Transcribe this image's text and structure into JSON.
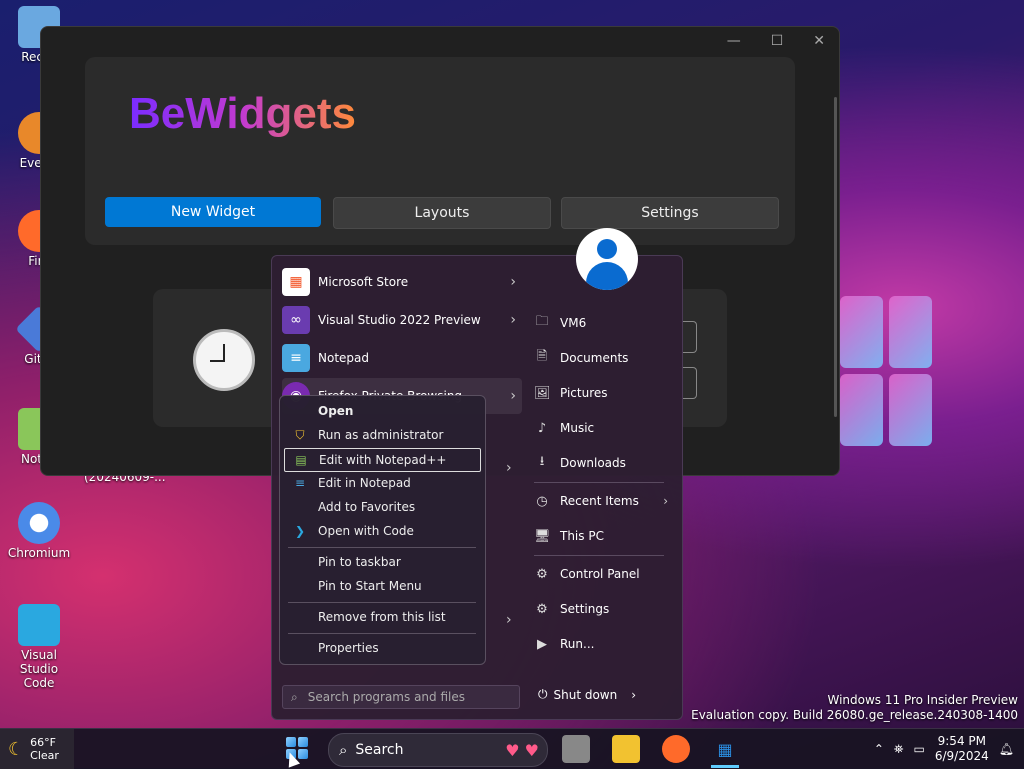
{
  "desktop": {
    "icons": [
      {
        "label": "Recyc",
        "icon": "recycle-bin-icon",
        "color": "#6aa8e0"
      },
      {
        "label": "Everyt",
        "icon": "everything-search-icon",
        "color": "#e8882a"
      },
      {
        "label": "Fire",
        "icon": "firefox-icon",
        "color": "#ff6a2a"
      },
      {
        "label": "Git B",
        "icon": "git-bash-icon",
        "color": "#4a7ad8"
      },
      {
        "label": "Notep",
        "icon": "notepadpp-icon",
        "color": "#8ac65a"
      },
      {
        "label": "Chromium",
        "icon": "chromium-icon",
        "color": "#4a8ae8"
      },
      {
        "label": "Visual Studio Code",
        "icon": "vscode-icon",
        "color": "#2aa8e0"
      }
    ],
    "stray_label": "(20240609-...",
    "eval_line1": "Windows 11 Pro Insider Preview",
    "eval_line2": "Evaluation copy. Build 26080.ge_release.240308-1400"
  },
  "bewidgets": {
    "title": "BeWidgets",
    "buttons": {
      "new_widget": "New Widget",
      "layouts": "Layouts",
      "settings": "Settings"
    },
    "window_controls": {
      "minimize": "—",
      "maximize": "☐",
      "close": "✕"
    }
  },
  "start_menu": {
    "programs": [
      {
        "label": "Microsoft Store",
        "icon": "microsoft-store-icon",
        "chevron": true
      },
      {
        "label": "Visual Studio 2022 Preview",
        "icon": "visual-studio-icon",
        "chevron": true
      },
      {
        "label": "Notepad",
        "icon": "notepad-icon",
        "chevron": false
      },
      {
        "label": "Firefox Private Browsing",
        "icon": "firefox-private-icon",
        "chevron": true
      }
    ],
    "right_items": [
      {
        "label": "VM6",
        "icon": "user-folder-icon",
        "glyph": "🗀"
      },
      {
        "label": "Documents",
        "icon": "documents-icon",
        "glyph": "🗎"
      },
      {
        "label": "Pictures",
        "icon": "pictures-icon",
        "glyph": "🖼"
      },
      {
        "label": "Music",
        "icon": "music-icon",
        "glyph": "♪"
      },
      {
        "label": "Downloads",
        "icon": "downloads-icon",
        "glyph": "⭳"
      },
      {
        "label": "Recent Items",
        "icon": "recent-items-icon",
        "glyph": "◷",
        "chevron": true
      },
      {
        "label": "This PC",
        "icon": "this-pc-icon",
        "glyph": "🖥"
      },
      {
        "label": "Control Panel",
        "icon": "control-panel-icon",
        "glyph": "⚙"
      },
      {
        "label": "Settings",
        "icon": "settings-gear-icon",
        "glyph": "⚙"
      },
      {
        "label": "Run...",
        "icon": "run-icon",
        "glyph": "▶"
      }
    ],
    "search_placeholder": "Search programs and files",
    "shutdown_label": "Shut down"
  },
  "context_menu": {
    "items": [
      {
        "label": "Open",
        "bold": true
      },
      {
        "label": "Run as administrator",
        "icon": "uac-shield-icon"
      },
      {
        "label": "Edit with Notepad++",
        "icon": "notepadpp-icon",
        "focus": true
      },
      {
        "label": "Edit in Notepad",
        "icon": "notepad-icon"
      },
      {
        "label": "Add to Favorites"
      },
      {
        "label": "Open with Code",
        "icon": "vscode-icon"
      },
      {
        "label": "Pin to taskbar"
      },
      {
        "label": "Pin to Start Menu"
      },
      {
        "label": "Remove from this list"
      },
      {
        "label": "Properties"
      }
    ]
  },
  "taskbar": {
    "weather_temp": "66°F",
    "weather_desc": "Clear",
    "search_label": "Search",
    "time": "9:54 PM",
    "date": "6/9/2024"
  }
}
